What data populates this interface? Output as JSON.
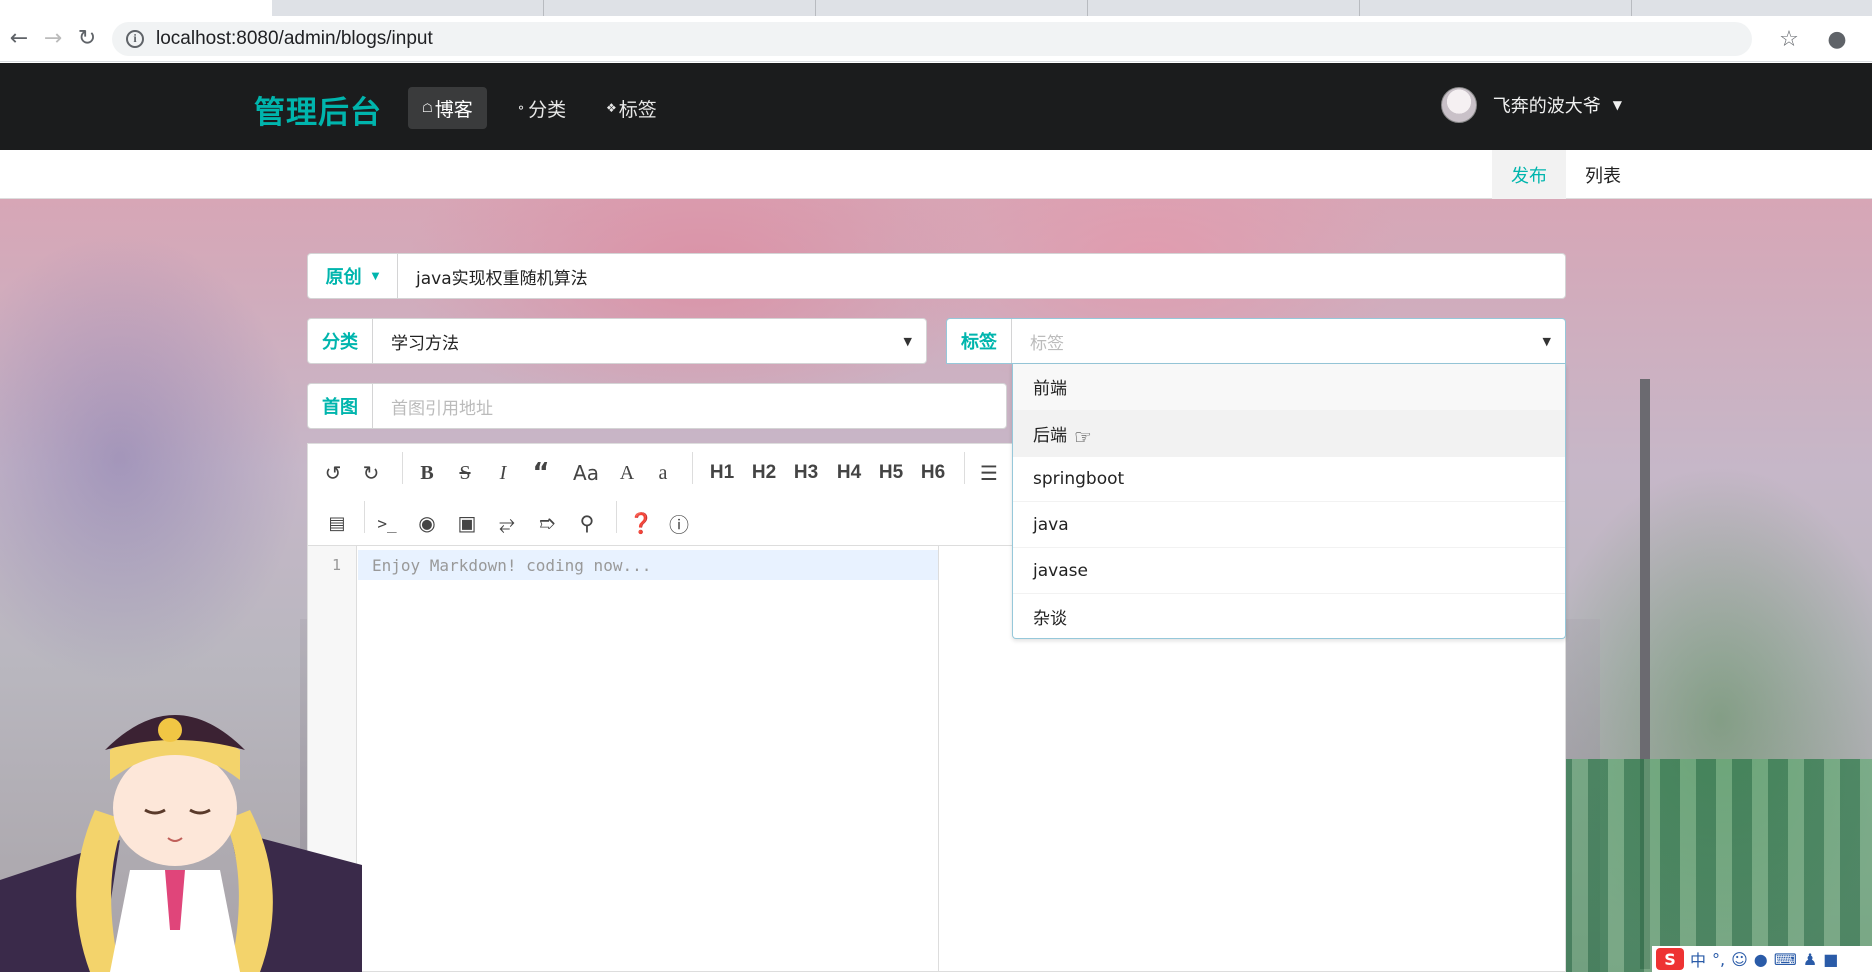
{
  "browser": {
    "url": "localhost:8080/admin/blogs/input"
  },
  "navbar": {
    "brand": "管理后台",
    "items": [
      {
        "label": "博客",
        "active": true
      },
      {
        "label": "分类",
        "active": false
      },
      {
        "label": "标签",
        "active": false
      }
    ],
    "user_name": "飞奔的波大爷"
  },
  "submenu": {
    "items": [
      {
        "label": "发布",
        "active": true
      },
      {
        "label": "列表",
        "active": false
      }
    ]
  },
  "form": {
    "type_label": "原创",
    "title_value": "java实现权重随机算法",
    "category_label": "分类",
    "category_value": "学习方法",
    "tag_label": "标签",
    "tag_placeholder": "标签",
    "image_label": "首图",
    "image_placeholder": "首图引用地址"
  },
  "tag_options": [
    "前端",
    "后端",
    "springboot",
    "java",
    "javase",
    "杂谈"
  ],
  "editor": {
    "toolbar_headings": [
      "H1",
      "H2",
      "H3",
      "H4",
      "H5",
      "H6"
    ],
    "line_number": "1",
    "placeholder": "Enjoy Markdown! coding now..."
  },
  "ime": {
    "lang": "中"
  },
  "colors": {
    "accent": "#00b5ad",
    "navbar": "#1b1c1d"
  }
}
